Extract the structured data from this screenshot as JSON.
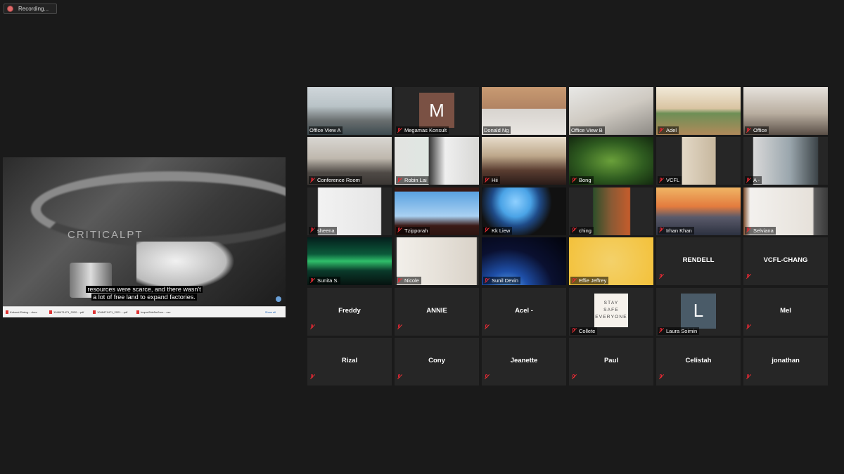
{
  "recording": {
    "label": "Recording..."
  },
  "share": {
    "caption_line1": "resources were scarce, and there wasn't",
    "caption_line2": "a lot of free land to expand factories.",
    "logo": "CRITICALPT",
    "downloads": [
      "Kokumi-Dialog....docx",
      "1048471471_2020....pdf",
      "1048471471_2021....pdf",
      "Inqmn2ble5m2um....csv"
    ],
    "show_all": "Show all"
  },
  "tiles": [
    {
      "name": "Office View A",
      "type": "video",
      "bg": "office-a"
    },
    {
      "name": "Megamas Konsult",
      "type": "avatar",
      "initial": "M",
      "avatar_color": "#7a5144"
    },
    {
      "name": "Donald Ng",
      "type": "video",
      "bg": "donald",
      "active": true
    },
    {
      "name": "Office View B",
      "type": "video",
      "bg": "office-b"
    },
    {
      "name": "Adel",
      "type": "video",
      "bg": "adel"
    },
    {
      "name": "Office",
      "type": "video",
      "bg": "office"
    },
    {
      "name": "Conference Room",
      "type": "video",
      "bg": "conference"
    },
    {
      "name": "Robin Lai",
      "type": "video",
      "bg": "robin"
    },
    {
      "name": "Hii",
      "type": "video",
      "bg": "hii"
    },
    {
      "name": "Bong",
      "type": "video",
      "bg": "jungle"
    },
    {
      "name": "VCFL",
      "type": "video",
      "bg": "vcfl"
    },
    {
      "name": "A -",
      "type": "video",
      "bg": "a-office"
    },
    {
      "name": "sheena",
      "type": "video",
      "bg": "sheena"
    },
    {
      "name": "Tzipporah",
      "type": "video",
      "bg": "sky"
    },
    {
      "name": "Kk Liew",
      "type": "video",
      "bg": "smurf"
    },
    {
      "name": "ching",
      "type": "video",
      "bg": "ching"
    },
    {
      "name": "Irhan Khan",
      "type": "video",
      "bg": "bridge"
    },
    {
      "name": "Selviana",
      "type": "video",
      "bg": "tv"
    },
    {
      "name": "Sunita S.",
      "type": "video",
      "bg": "aurora"
    },
    {
      "name": "Nicole",
      "type": "video",
      "bg": "shelf"
    },
    {
      "name": "Sunil Devin",
      "type": "video",
      "bg": "earth"
    },
    {
      "name": "Effie Jeffrey",
      "type": "video",
      "bg": "emoji"
    },
    {
      "name": "RENDELL",
      "type": "name"
    },
    {
      "name": "VCFL-CHANG",
      "type": "name"
    },
    {
      "name": "Freddy",
      "type": "name"
    },
    {
      "name": "ANNIE",
      "type": "name"
    },
    {
      "name": "Acel -",
      "type": "name"
    },
    {
      "name": "Collete",
      "type": "sign",
      "sign_lines": [
        "STAY",
        "SAFE",
        "EVERYONE"
      ]
    },
    {
      "name": "Laura Soimin",
      "type": "avatar",
      "initial": "L",
      "avatar_color": "#4a5b68"
    },
    {
      "name": "Mel",
      "type": "name"
    },
    {
      "name": "Rizal",
      "type": "name"
    },
    {
      "name": "Cony",
      "type": "name"
    },
    {
      "name": "Jeanette",
      "type": "name"
    },
    {
      "name": "Paul",
      "type": "name"
    },
    {
      "name": "Celistah",
      "type": "name"
    },
    {
      "name": "jonathan",
      "type": "name"
    }
  ],
  "icons": {
    "mic": "mic-muted-icon",
    "recording": "recording-dot-icon"
  },
  "colors": {
    "background": "#1a1a1a",
    "tile": "#262626",
    "active_speaker": "#c9d943",
    "muted": "#d22233"
  }
}
